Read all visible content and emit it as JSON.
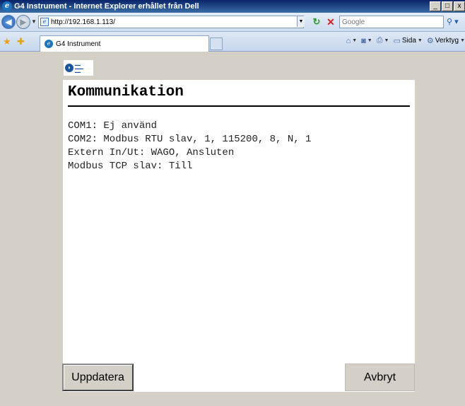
{
  "window": {
    "title": "G4 Instrument - Internet Explorer erhållet från Dell",
    "min_label": "_",
    "max_label": "□",
    "close_label": "x"
  },
  "address": {
    "url": "http://192.168.1.113/",
    "search_placeholder": "Google"
  },
  "tabs": {
    "active_label": "G4 Instrument"
  },
  "commands": {
    "page_label": "Sida",
    "tools_label": "Verktyg"
  },
  "page": {
    "title": "Kommunikation",
    "lines": [
      "COM1: Ej använd",
      "COM2: Modbus RTU slav, 1, 115200, 8, N, 1",
      "Extern In/Ut: WAGO, Ansluten",
      "Modbus TCP slav: Till"
    ],
    "update_button": "Uppdatera",
    "cancel_button": "Avbryt"
  },
  "icons": {
    "back": "back-arrow-icon",
    "forward": "forward-arrow-icon",
    "refresh": "refresh-icon",
    "stop": "stop-icon",
    "search": "search-icon",
    "favorites": "favorites-star-icon",
    "add_favorite": "add-favorites-icon",
    "home": "home-icon",
    "feeds": "feeds-icon",
    "print": "print-icon",
    "page": "page-icon",
    "tools": "tools-gear-icon"
  },
  "colors": {
    "titlebar": "#0a246a",
    "page_background": "#d4d0c8",
    "panel_background": "#ffffff"
  }
}
